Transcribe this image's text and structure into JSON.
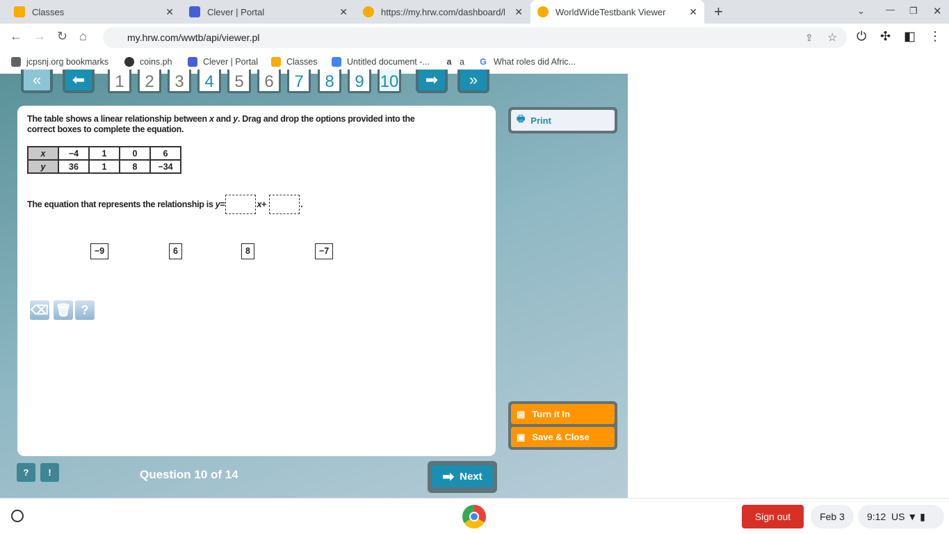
{
  "browser": {
    "tabs": [
      {
        "title": "Classes",
        "color": "#f9ab00"
      },
      {
        "title": "Clever | Portal",
        "color": "#4261d6"
      },
      {
        "title": "https://my.hrw.com/dashboard/l",
        "color": "#f9ab00"
      },
      {
        "title": "WorldWideTestbank Viewer",
        "color": "#f9ab00"
      }
    ],
    "url": "my.hrw.com/wwtb/api/viewer.pl",
    "bookmarks": [
      "jcpsnj.org bookmarks",
      "coins.ph",
      "Clever | Portal",
      "Classes",
      "Untitled document -...",
      "a",
      "What roles did Afric..."
    ]
  },
  "nav": {
    "questions": [
      "1",
      "2",
      "3",
      "4",
      "5",
      "6",
      "7",
      "8",
      "9",
      "10"
    ],
    "answered": [
      "4",
      "7",
      "8",
      "9"
    ],
    "current": "10"
  },
  "question": {
    "text_parts": [
      "The table shows a linear relationship between ",
      "x",
      " and ",
      "y",
      ". Drag and drop the options provided into the correct boxes to complete the equation."
    ],
    "table": {
      "x_label": "x",
      "y_label": "y",
      "x": [
        "−4",
        "1",
        "0",
        "6"
      ],
      "y": [
        "36",
        "1",
        "8",
        "−34"
      ]
    },
    "equation": {
      "prefix": "The equation that represents the relationship is ",
      "y": "y",
      "eq": " =",
      "x": "x",
      "plus": " +",
      "end": "."
    },
    "options": [
      "−9",
      "6",
      "8",
      "−7"
    ]
  },
  "side": {
    "print": "Print",
    "turn_in": "Turn it In",
    "save_close": "Save & Close"
  },
  "footer": {
    "counter": "Question 10 of 14",
    "next": "Next",
    "help": "?",
    "alert": "!"
  },
  "shelf": {
    "sign_out": "Sign out",
    "date": "Feb 3",
    "time": "9:12",
    "locale": "US"
  }
}
